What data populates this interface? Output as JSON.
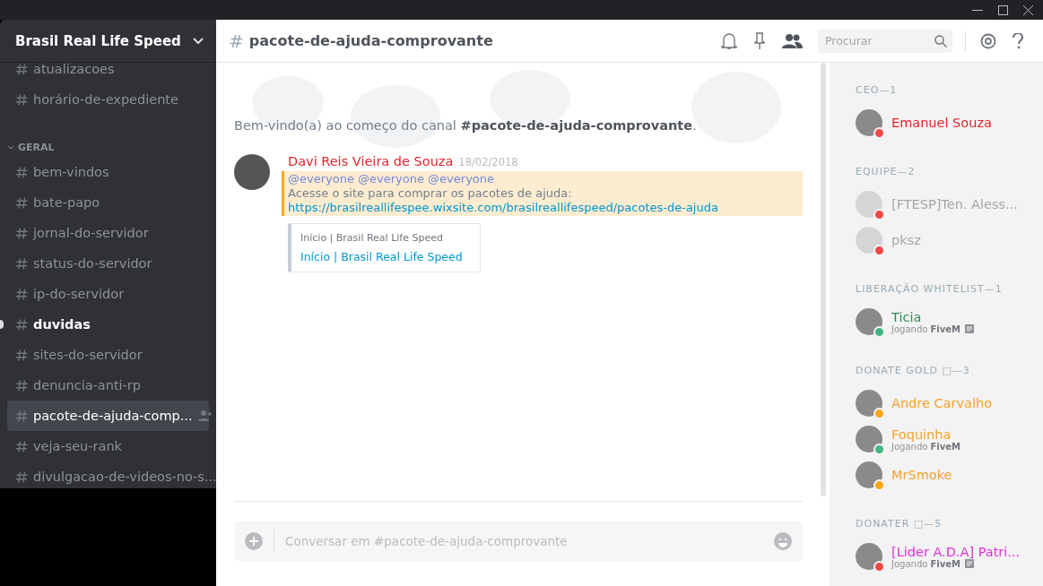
{
  "server": {
    "name": "Brasil Real Life Speed"
  },
  "channels_top": [
    {
      "name": "atualizacoes",
      "selected": false,
      "unread": false
    },
    {
      "name": "horário-de-expediente",
      "selected": false,
      "unread": false
    }
  ],
  "category": {
    "name": "GERAL",
    "expanded": true
  },
  "channels": [
    {
      "name": "bem-vindos",
      "selected": false,
      "unread": false
    },
    {
      "name": "bate-papo",
      "selected": false,
      "unread": false
    },
    {
      "name": "jornal-do-servidor",
      "selected": false,
      "unread": false
    },
    {
      "name": "status-do-servidor",
      "selected": false,
      "unread": false
    },
    {
      "name": "ip-do-servidor",
      "selected": false,
      "unread": false
    },
    {
      "name": "duvidas",
      "selected": false,
      "unread": true
    },
    {
      "name": "sites-do-servidor",
      "selected": false,
      "unread": false
    },
    {
      "name": "denuncia-anti-rp",
      "selected": false,
      "unread": false
    },
    {
      "name": "pacote-de-ajuda-comp...",
      "selected": true,
      "unread": false
    },
    {
      "name": "veja-seu-rank",
      "selected": false,
      "unread": false
    },
    {
      "name": "divulgacao-de-videos-no-s...",
      "selected": false,
      "unread": false
    }
  ],
  "header": {
    "hash": "#",
    "channel": "pacote-de-ajuda-comprovante",
    "search_placeholder": "Procurar"
  },
  "welcome": "Bem-vindo(a) ao começo do canal **#pacote-de-ajuda-comprovante**.",
  "message": {
    "author": {
      "name": "Davi Reis Vieira de Souza",
      "color": "#e0262b"
    },
    "time": "18/02/2018",
    "mentioned": true,
    "lines": [
      {
        "kind": "mention",
        "text": "@everyone @everyone @everyone"
      },
      {
        "kind": "text",
        "text": "Acesse o site para comprar os pacotes de ajuda:"
      },
      {
        "kind": "link",
        "text": "https://brasilreallifespee.wixsite.com/brasilreallifespeed/pacotes-de-ajuda"
      }
    ],
    "embed": {
      "provider": "Início | Brasil Real Life Speed",
      "title": "Início | Brasil Real Life Speed"
    }
  },
  "composer": {
    "placeholder": "Conversar em #pacote-de-ajuda-comprovante"
  },
  "member_groups": [
    {
      "title": "CEO—1",
      "members": [
        {
          "name": "Emanuel Souza",
          "color": "#e0262b",
          "status": {
            "color": "#f04747"
          },
          "faded": false
        }
      ]
    },
    {
      "title": "EQUIPE—2",
      "members": [
        {
          "name": "[FTESP]Ten. Aless...",
          "color": "#a3a6aa",
          "status": {
            "color": "#f04747"
          },
          "faded": true
        },
        {
          "name": "pksz",
          "color": "#a3a6aa",
          "status": {
            "color": "#f04747"
          },
          "faded": true
        }
      ]
    },
    {
      "title": "LIBERAÇÃO WHITELIST—1",
      "members": [
        {
          "name": "Ticia",
          "color": "#2e8b57",
          "status": {
            "color": "#43b581"
          },
          "faded": false,
          "activity": "Jogando **FiveM**",
          "details": true
        }
      ]
    },
    {
      "title": "DONATE GOLD □—3",
      "members": [
        {
          "name": "Andre Carvalho",
          "color": "#f5a12a",
          "status": {
            "color": "#faa61a"
          },
          "faded": false
        },
        {
          "name": "Foquinha",
          "color": "#f5a12a",
          "status": {
            "color": "#43b581"
          },
          "faded": false,
          "activity": "Jogando **FiveM**",
          "details": false
        },
        {
          "name": "MrSmoke",
          "color": "#f5a12a",
          "status": {
            "color": "#faa61a"
          },
          "faded": false
        }
      ]
    },
    {
      "title": "DONATER □—5",
      "members": [
        {
          "name": "[Lider A.D.A] Patri...",
          "color": "#e030d8",
          "status": {
            "color": "#f04747"
          },
          "faded": false,
          "activity": "Jogando **FiveM**",
          "details": true
        }
      ]
    }
  ]
}
